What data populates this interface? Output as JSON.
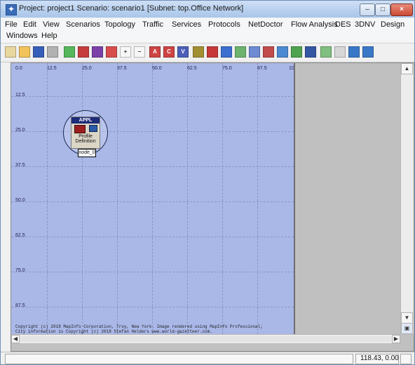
{
  "window": {
    "title": "Project: project1 Scenario: scenario1  [Subnet: top.Office Network]",
    "controls": [
      "–",
      "□",
      "×"
    ]
  },
  "menu": {
    "items": [
      "File",
      "Edit",
      "View",
      "Scenarios",
      "Topology",
      "Traffic",
      "Services",
      "Protocols",
      "NetDoctor",
      "Flow Analysis",
      "DES",
      "3DNV",
      "Design",
      "Windows",
      "Help"
    ]
  },
  "toolbar": {
    "icons": [
      "new-project-icon",
      "open-icon",
      "save-icon",
      "print-icon",
      "topology-icon",
      "red-tool-icon",
      "module-tool-icon",
      "lock-icon",
      "zoom-in-icon",
      "zoom-out-icon",
      "ace-icon",
      "ctr-icon",
      "vne-icon",
      "traffic-icon",
      "assign-icon",
      "warning-icon",
      "graph-icon",
      "tree-icon",
      "edit-icon",
      "flow-icon",
      "image-icon",
      "report-icon",
      "run-icon",
      "net-icon",
      "ref-icon",
      "scale-icon"
    ]
  },
  "axes": {
    "x_ticks": [
      "0.0",
      "12.5",
      "25.0",
      "37.5",
      "50.0",
      "62.5",
      "75.0",
      "87.5",
      "10"
    ],
    "y_ticks": [
      "12.5",
      "25.0",
      "37.5",
      "50.0",
      "62.5",
      "75.0",
      "87.5"
    ]
  },
  "node": {
    "badge": "APPL",
    "name_line1": "Profile",
    "name_line2": "Definition",
    "label": "node_0"
  },
  "copyright": {
    "line1": "Copyright (c) 2018 MapInfo Corporation, Troy, New York. Image rendered using MapInfo Professional;",
    "line2": "City information is Copyright (c) 2018 Stefan Helders www.world-gazetteer.com."
  },
  "status": {
    "coordinates": "118.43, 0.00"
  },
  "colors": {
    "canvas": "#aab8e8",
    "workspace": "#c0c0c0",
    "titlebar": "#b7cfee"
  }
}
